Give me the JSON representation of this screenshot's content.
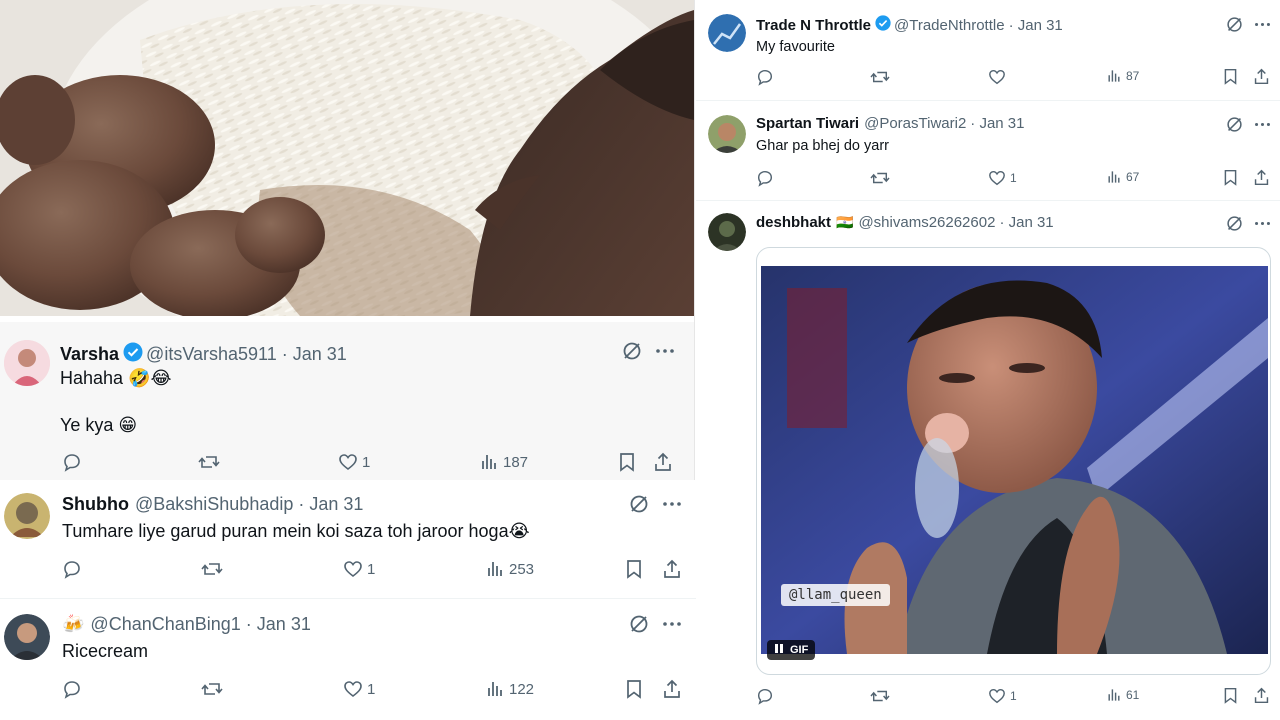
{
  "colors": {
    "text": "#0f1419",
    "muted": "#536471",
    "verified": "#1d9bf0",
    "divider": "#eff3f4"
  },
  "left_tweets": [
    {
      "name": "Varsha",
      "verified": true,
      "handle": "@itsVarsha5911",
      "date": "· Jan 31",
      "lines": [
        "Hahaha 🤣😂",
        "Ye kya 😁"
      ],
      "likes": "1",
      "views": "187"
    },
    {
      "name": "Shubho",
      "verified": false,
      "handle": "@BakshiShubhadip",
      "date": "· Jan 31",
      "lines": [
        "Tumhare liye garud puran mein koi saza toh jaroor hoga😭"
      ],
      "likes": "1",
      "views": "253"
    },
    {
      "name": "",
      "name_emoji": "🍻",
      "verified": false,
      "handle": "@ChanChanBing1",
      "date": "· Jan 31",
      "lines": [
        "Ricecream"
      ],
      "likes": "1",
      "views": "122"
    }
  ],
  "right_tweets": [
    {
      "name": "Trade N Throttle",
      "verified": true,
      "handle": "@TradeNthrottle",
      "date": "· Jan 31",
      "lines": [
        "My favourite"
      ],
      "likes": "",
      "views": "87"
    },
    {
      "name": "Spartan Tiwari",
      "verified": false,
      "handle": "@PorasTiwari2",
      "date": "· Jan 31",
      "lines": [
        "Ghar pa bhej do yarr"
      ],
      "likes": "1",
      "views": "67"
    },
    {
      "name": "deshbhakt",
      "name_emoji": "🇮🇳",
      "verified": false,
      "handle": "@shivams26262602",
      "date": "· Jan 31",
      "lines": [],
      "likes": "1",
      "views": "61",
      "media": {
        "badge": "GIF",
        "watermark": "@llam_queen"
      }
    }
  ],
  "icons": [
    "reply-icon",
    "retweet-icon",
    "like-icon",
    "views-icon",
    "bookmark-icon",
    "share-icon",
    "grok-icon",
    "more-icon"
  ]
}
